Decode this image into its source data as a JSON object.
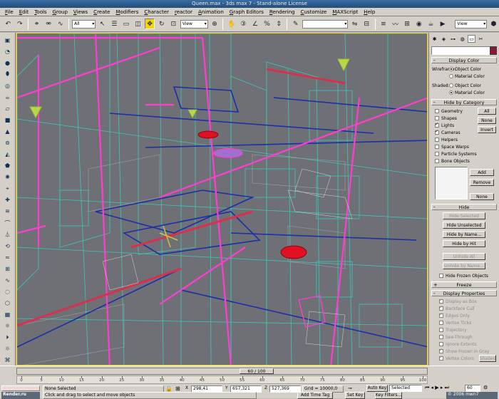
{
  "window": {
    "title": "Queen.max  - 3ds max 7 - Stand-alone License"
  },
  "menu": [
    "File",
    "Edit",
    "Tools",
    "Group",
    "Views",
    "Create",
    "Modifiers",
    "Character",
    "reactor",
    "Animation",
    "Graph Editors",
    "Rendering",
    "Customize",
    "MAXScript",
    "Help"
  ],
  "toolbar": {
    "selection_filter": "All",
    "ref_coord": "View",
    "cmd_view": "View"
  },
  "command_panel": {
    "display_color": {
      "title": "Display Color",
      "wireframe_label": "Wireframe:",
      "shaded_label": "Shaded:",
      "opt_object": "Object Color",
      "opt_material": "Material Color"
    },
    "hide_by_category": {
      "title": "Hide by Category",
      "items": [
        {
          "label": "Geometry",
          "checked": false
        },
        {
          "label": "Shapes",
          "checked": false
        },
        {
          "label": "Lights",
          "checked": true
        },
        {
          "label": "Cameras",
          "checked": true
        },
        {
          "label": "Helpers",
          "checked": false
        },
        {
          "label": "Space Warps",
          "checked": false
        },
        {
          "label": "Particle Systems",
          "checked": false
        },
        {
          "label": "Bone Objects",
          "checked": false
        }
      ],
      "btn_all": "All",
      "btn_none": "None",
      "btn_invert": "Invert",
      "btn_add": "Add",
      "btn_remove": "Remove",
      "btn_none2": "None"
    },
    "hide": {
      "title": "Hide",
      "hide_selected": "Hide Selected",
      "hide_unselected": "Hide Unselected",
      "hide_by_name": "Hide by Name...",
      "hide_by_hit": "Hide by Hit",
      "unhide_all": "Unhide All",
      "unhide_by_name": "Unhide by Name...",
      "hide_frozen": "Hide Frozen Objects"
    },
    "freeze": {
      "title": "Freeze",
      "sign": "+"
    },
    "display_properties": {
      "title": "Display Properties",
      "sign": "-",
      "items": [
        {
          "label": "Display as Box",
          "checked": true
        },
        {
          "label": "Backface Cull",
          "checked": true
        },
        {
          "label": "Edges Only",
          "checked": true
        },
        {
          "label": "Vertex Ticks",
          "checked": false
        },
        {
          "label": "Trajectory",
          "checked": false
        },
        {
          "label": "See-Through",
          "checked": false
        },
        {
          "label": "Ignore Extents",
          "checked": false
        },
        {
          "label": "Show Frozen in Gray",
          "checked": true
        },
        {
          "label": "Vertex Colors",
          "checked": true
        }
      ],
      "shaded_btn": "Shaded"
    }
  },
  "timeline": {
    "frame_label": "60 / 100",
    "ticks": [
      "0",
      "5",
      "10",
      "15",
      "20",
      "25",
      "30",
      "35",
      "40",
      "45",
      "50",
      "55",
      "60",
      "65",
      "70",
      "75",
      "80",
      "85",
      "90",
      "95",
      "100"
    ]
  },
  "status": {
    "selection": "None Selected",
    "prompt": "Click and drag to select and move objects",
    "x_label": "X",
    "x_value": "298,41",
    "y_label": "Y",
    "y_value": "657,321",
    "z_label": "Z",
    "z_value": "527,369",
    "grid": "Grid = 10000,0",
    "add_time_tag": "Add Time Tag",
    "auto_key": "Auto Key",
    "set_key": "Set Key",
    "key_filters": "Key Filters...",
    "selected_drop": "Selected",
    "frame": "60",
    "watermark_left": "Render.ru",
    "watermark_right": "© 2006 mwn7"
  },
  "colors": {
    "viewport_bg": "#6f7075",
    "selected_wire": "#ff3dd0",
    "accent": "#f6d400"
  }
}
